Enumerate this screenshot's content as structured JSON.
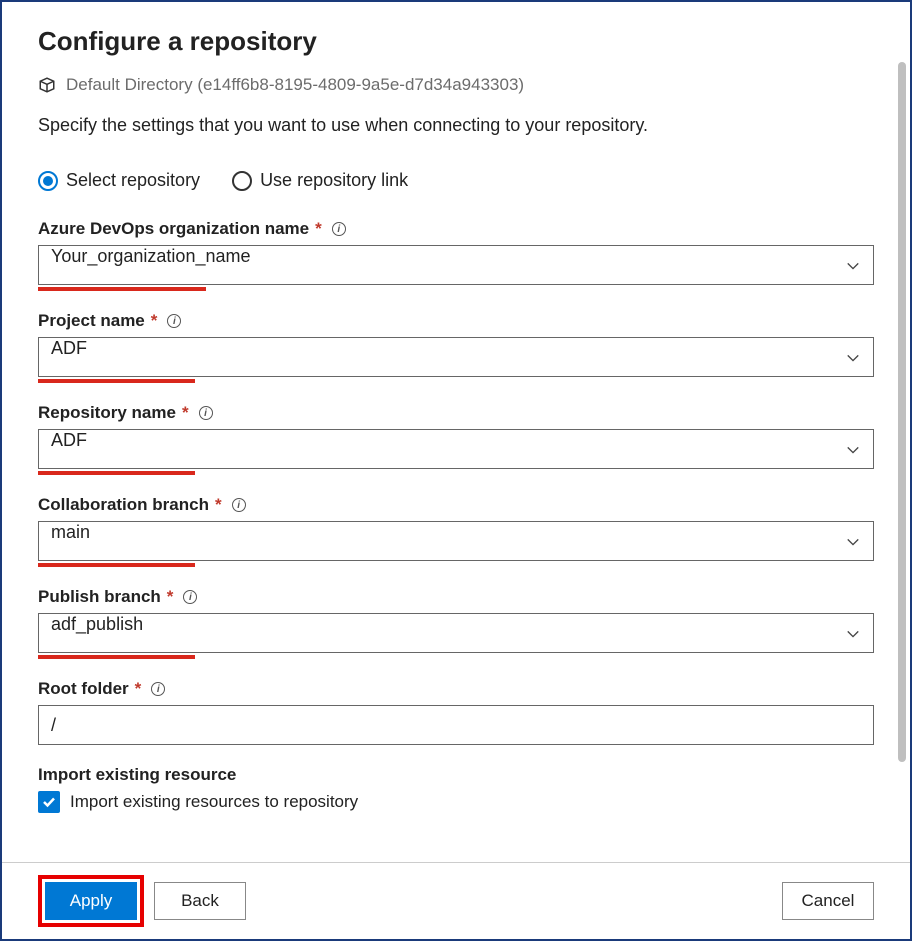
{
  "page": {
    "title": "Configure a repository",
    "directory_label": "Default Directory (e14ff6b8-8195-4809-9a5e-d7d34a943303)",
    "description": "Specify the settings that you want to use when connecting to your repository."
  },
  "radio": {
    "select_repo": "Select repository",
    "use_link": "Use repository link",
    "selected": "select_repo"
  },
  "fields": {
    "org": {
      "label": "Azure DevOps organization name",
      "value": "Your_organization_name",
      "underline_width": 168
    },
    "project": {
      "label": "Project name",
      "value": "ADF",
      "underline_width": 157
    },
    "repo": {
      "label": "Repository name",
      "value": "ADF",
      "underline_width": 157
    },
    "collab": {
      "label": "Collaboration branch",
      "value": "main",
      "underline_width": 157
    },
    "publish": {
      "label": "Publish branch",
      "value": "adf_publish",
      "underline_width": 157
    },
    "root": {
      "label": "Root folder",
      "value": "/"
    }
  },
  "import": {
    "section_label": "Import existing resource",
    "checkbox_label": "Import existing resources to repository",
    "checked": true
  },
  "buttons": {
    "apply": "Apply",
    "back": "Back",
    "cancel": "Cancel"
  }
}
